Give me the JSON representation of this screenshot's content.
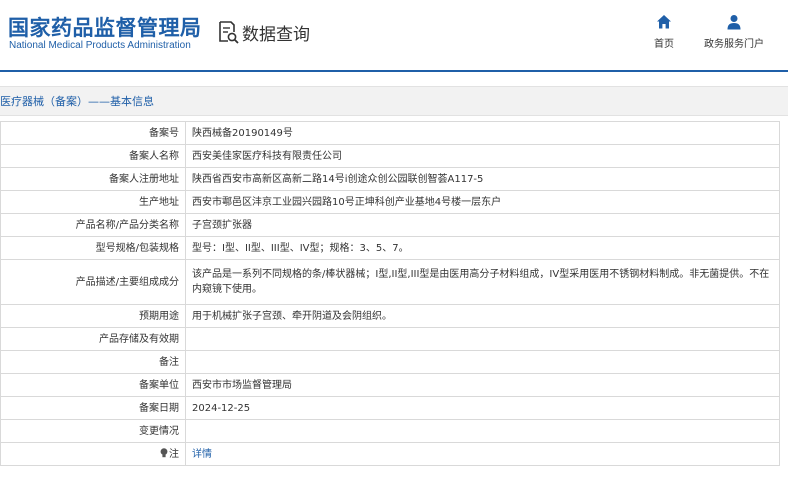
{
  "header": {
    "logo_cn": "国家药品监督管理局",
    "logo_en": "National Medical Products Administration",
    "query_label": "数据查询",
    "nav": [
      {
        "label": "首页",
        "icon": "home-icon"
      },
      {
        "label": "政务服务门户",
        "icon": "user-icon"
      }
    ]
  },
  "breadcrumb": "医疗器械（备案）——基本信息",
  "record": {
    "rows": [
      {
        "label": "备案号",
        "value": "陕西械备20190149号"
      },
      {
        "label": "备案人名称",
        "value": "西安美佳家医疗科技有限责任公司"
      },
      {
        "label": "备案人注册地址",
        "value": "陕西省西安市高新区高新二路14号i创途众创公园联创智荟A117-5"
      },
      {
        "label": "生产地址",
        "value": "西安市鄠邑区沣京工业园兴园路10号正坤科创产业基地4号楼一层东户"
      },
      {
        "label": "产品名称/产品分类名称",
        "value": "子宫颈扩张器"
      },
      {
        "label": "型号规格/包装规格",
        "value": "型号：I型、II型、III型、IV型；规格：3、5、7。"
      },
      {
        "label": "产品描述/主要组成成分",
        "value": "该产品是一系列不同规格的条/棒状器械；I型,II型,III型是由医用高分子材料组成，IV型采用医用不锈钢材料制成。非无菌提供。不在内窥镜下使用。"
      },
      {
        "label": "预期用途",
        "value": "用于机械扩张子宫颈、牵开阴道及会阴组织。"
      },
      {
        "label": "产品存储及有效期",
        "value": ""
      },
      {
        "label": "备注",
        "value": ""
      },
      {
        "label": "备案单位",
        "value": "西安市市场监督管理局"
      },
      {
        "label": "备案日期",
        "value": "2024-12-25"
      },
      {
        "label": "变更情况",
        "value": ""
      }
    ],
    "note": {
      "label": "注",
      "icon": "bulb-icon",
      "link": "详情"
    }
  },
  "colors": {
    "brand": "#1f5fa8",
    "border": "#d9d9d9",
    "crumb_bg": "#f2f2f2"
  }
}
